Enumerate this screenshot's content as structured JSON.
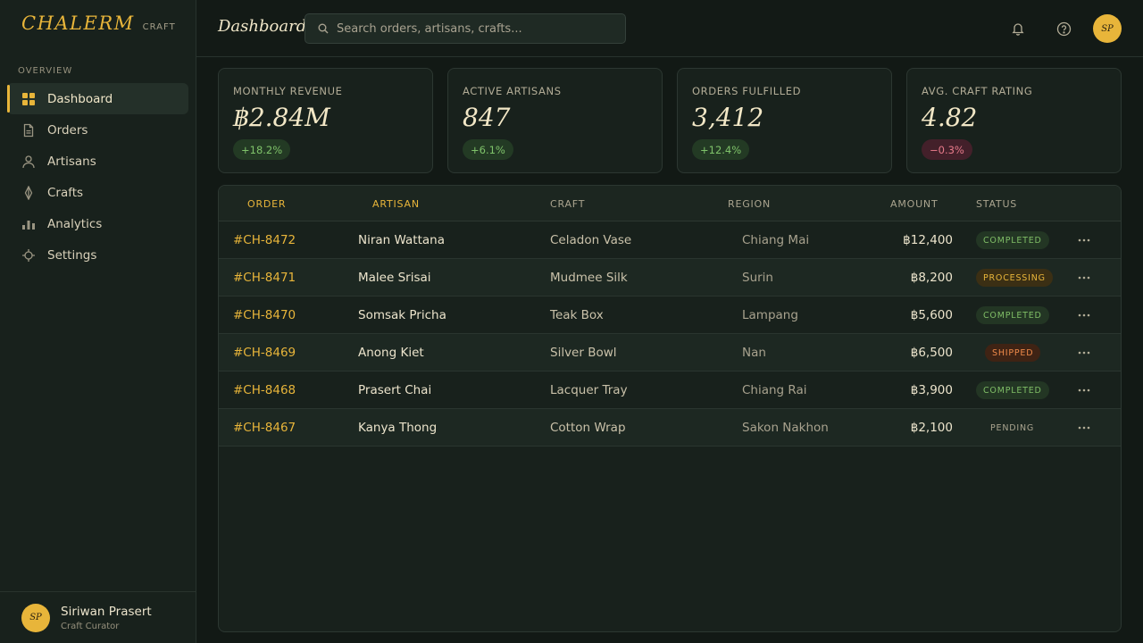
{
  "brand": {
    "name": "CHALERM",
    "sub": "CRAFT"
  },
  "sidebar": {
    "section": "OVERVIEW",
    "items": [
      {
        "label": "Dashboard",
        "icon": "grid-icon",
        "active": true
      },
      {
        "label": "Orders",
        "icon": "document-icon"
      },
      {
        "label": "Artisans",
        "icon": "user-icon"
      },
      {
        "label": "Crafts",
        "icon": "diamond-icon"
      },
      {
        "label": "Analytics",
        "icon": "bar-chart-icon"
      },
      {
        "label": "Settings",
        "icon": "gear-icon"
      }
    ],
    "user": {
      "initials": "SP",
      "name": "Siriwan Prasert",
      "role": "Craft Curator"
    }
  },
  "header": {
    "title": "Dashboard",
    "search_placeholder": "Search orders, artisans, crafts...",
    "avatar_initials": "SP"
  },
  "stats": [
    {
      "label": "MONTHLY REVENUE",
      "value": "฿2.84M",
      "delta": "+18.2%",
      "trend": "up"
    },
    {
      "label": "ACTIVE ARTISANS",
      "value": "847",
      "delta": "+6.1%",
      "trend": "up"
    },
    {
      "label": "ORDERS FULFILLED",
      "value": "3,412",
      "delta": "+12.4%",
      "trend": "up"
    },
    {
      "label": "AVG. CRAFT RATING",
      "value": "4.82",
      "delta": "−0.3%",
      "trend": "down"
    }
  ],
  "table": {
    "columns": {
      "order": "ORDER",
      "artisan": "ARTISAN",
      "craft": "CRAFT",
      "region": "REGION",
      "amount": "AMOUNT",
      "status": "STATUS"
    },
    "rows": [
      {
        "order": "#CH-8472",
        "artisan": "Niran Wattana",
        "craft": "Celadon Vase",
        "region": "Chiang Mai",
        "amount": "฿12,400",
        "status": "COMPLETED"
      },
      {
        "order": "#CH-8471",
        "artisan": "Malee Srisai",
        "craft": "Mudmee Silk",
        "region": "Surin",
        "amount": "฿8,200",
        "status": "PROCESSING"
      },
      {
        "order": "#CH-8470",
        "artisan": "Somsak Pricha",
        "craft": "Teak Box",
        "region": "Lampang",
        "amount": "฿5,600",
        "status": "COMPLETED"
      },
      {
        "order": "#CH-8469",
        "artisan": "Anong Kiet",
        "craft": "Silver Bowl",
        "region": "Nan",
        "amount": "฿6,500",
        "status": "SHIPPED"
      },
      {
        "order": "#CH-8468",
        "artisan": "Prasert Chai",
        "craft": "Lacquer Tray",
        "region": "Chiang Rai",
        "amount": "฿3,900",
        "status": "COMPLETED"
      },
      {
        "order": "#CH-8467",
        "artisan": "Kanya Thong",
        "craft": "Cotton Wrap",
        "region": "Sakon Nakhon",
        "amount": "฿2,100",
        "status": "PENDING"
      }
    ]
  },
  "colors": {
    "accent": "#e8b53a",
    "background": "#121915",
    "panel": "#18211c",
    "positive": "#7fc36a",
    "negative": "#e77a8a"
  }
}
